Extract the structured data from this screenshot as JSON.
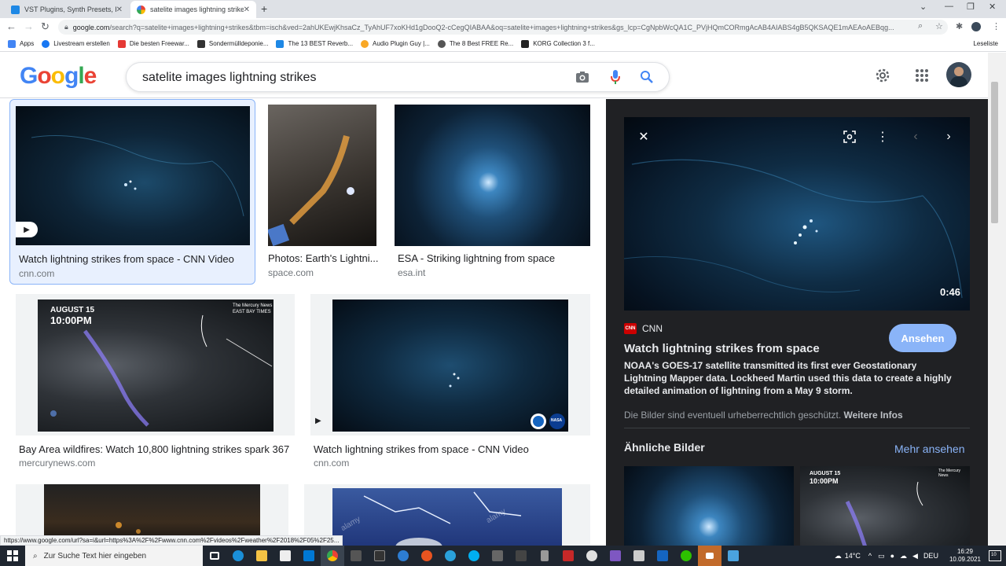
{
  "browser": {
    "tabs": [
      {
        "title": "VST Plugins, Synth Presets, Effect"
      },
      {
        "title": "satelite images lightning strikes"
      }
    ],
    "url_main": "google.com",
    "url_rest": "/search?q=satelite+images+lightning+strikes&tbm=isch&ved=2ahUKEwjKhsaCz_TyAhUF7xoKHd1gDooQ2-cCegQIABAA&oq=satelite+images+lightning+strikes&gs_lcp=CgNpbWcQA1C_PVjHQmCORmgAcAB4AIABS4gB5QKSAQE1mAEAoAEBqg...",
    "new_tab": "+",
    "bookmarks": [
      {
        "label": "Apps",
        "color": "#4285f4"
      },
      {
        "label": "Livestream erstellen",
        "color": "#1877f2"
      },
      {
        "label": "Die besten Freewar...",
        "color": "#e53935"
      },
      {
        "label": "Sondermülldeponie...",
        "color": "#333333"
      },
      {
        "label": "The 13 BEST Reverb...",
        "color": "#1e88e5"
      },
      {
        "label": "Audio Plugin Guy |...",
        "color": "#f9a825"
      },
      {
        "label": "The 8 Best FREE Re...",
        "color": "#555555"
      },
      {
        "label": "KORG Collection 3 f...",
        "color": "#222222"
      }
    ],
    "reading_list": "Leseliste"
  },
  "search": {
    "query": "satelite images lightning strikes"
  },
  "results": [
    {
      "title": "Watch lightning strikes from space - CNN Video",
      "source": "cnn.com"
    },
    {
      "title": "Photos: Earth's Lightni...",
      "source": "space.com"
    },
    {
      "title": "ESA - Striking lightning from space",
      "source": "esa.int"
    },
    {
      "title": "Bay Area wildfires: Watch 10,800 lightning strikes spark 367 ...",
      "source": "mercurynews.com"
    },
    {
      "title": "Watch lightning strikes from space - CNN Video",
      "source": "cnn.com"
    }
  ],
  "overlay_text": {
    "date": "AUGUST 15",
    "time": "10:00PM",
    "paper": "The Mercury News",
    "paper2": "EAST BAY TIMES",
    "nasa": "NASA",
    "alamy": "alamy"
  },
  "panel": {
    "duration": "0:46",
    "source": "CNN",
    "cnn_logo": "CNN",
    "view_button": "Ansehen",
    "title": "Watch lightning strikes from space",
    "description": "NOAA's GOES-17 satellite transmitted its first ever Geostationary Lightning Mapper data. Lockheed Martin used this data to create a highly detailed animation of lightning from a May 9 storm.",
    "copyright": "Die Bilder sind eventuell urheberrechtlich geschützt.",
    "more_info": "Weitere Infos",
    "similar_heading": "Ähnliche Bilder",
    "see_more": "Mehr ansehen"
  },
  "status_url": "https://www.google.com/url?sa=i&url=https%3A%2F%2Fwww.cnn.com%2Fvideos%2Fweather%2F2018%2F05%2F25...",
  "taskbar": {
    "search_placeholder": "Zur Suche Text hier eingeben",
    "temperature": "14°C",
    "language": "DEU",
    "time": "16:29",
    "date": "10.09.2021",
    "notification_count": "10"
  },
  "colors": {
    "google_blue": "#4285f4",
    "google_red": "#ea4335",
    "google_yellow": "#fbbc05",
    "google_green": "#34a853",
    "panel_bg": "#202124",
    "accent": "#8ab4f8"
  }
}
